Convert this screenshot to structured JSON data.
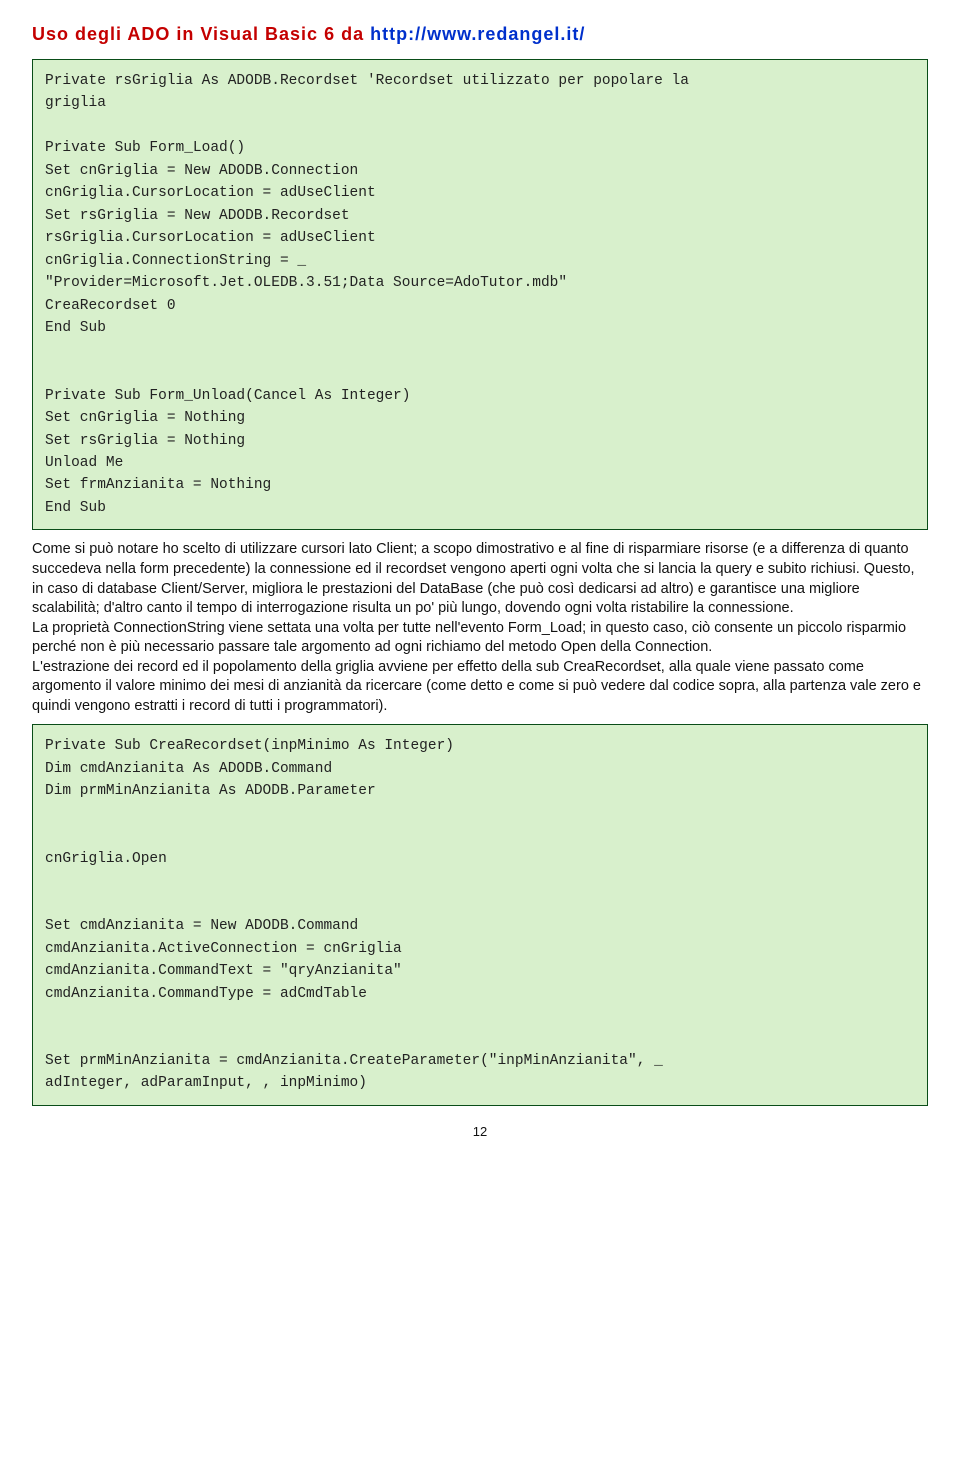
{
  "header": {
    "title_red": "Uso degli ADO in Visual Basic 6 da ",
    "title_blue": "http://www.redangel.it/"
  },
  "code1": "Private rsGriglia As ADODB.Recordset 'Recordset utilizzato per popolare la\ngriglia\n\nPrivate Sub Form_Load()\nSet cnGriglia = New ADODB.Connection\ncnGriglia.CursorLocation = adUseClient\nSet rsGriglia = New ADODB.Recordset\nrsGriglia.CursorLocation = adUseClient\ncnGriglia.ConnectionString = _\n\"Provider=Microsoft.Jet.OLEDB.3.51;Data Source=AdoTutor.mdb\"\nCreaRecordset 0\nEnd Sub\n\n\nPrivate Sub Form_Unload(Cancel As Integer)\nSet cnGriglia = Nothing\nSet rsGriglia = Nothing\nUnload Me\nSet frmAnzianita = Nothing\nEnd Sub",
  "paragraph": "Come si può notare ho scelto di utilizzare cursori lato Client; a scopo dimostrativo e al fine di risparmiare risorse (e a differenza di quanto succedeva nella form precedente) la connessione ed il recordset vengono aperti ogni volta che si lancia la query e subito richiusi. Questo, in caso di database Client/Server, migliora le prestazioni del DataBase (che può così dedicarsi ad altro) e garantisce una migliore scalabilità; d'altro canto il tempo di interrogazione risulta un po' più lungo, dovendo ogni volta ristabilire la connessione.\nLa proprietà ConnectionString viene settata una volta per tutte nell'evento Form_Load; in questo caso, ciò consente un piccolo risparmio perché non è più necessario passare tale argomento ad ogni richiamo del metodo Open della Connection.\nL'estrazione dei record ed il popolamento della griglia avviene per effetto della sub CreaRecordset, alla quale viene passato come argomento il valore minimo dei mesi di anzianità da ricercare (come detto e come si può vedere dal codice sopra, alla partenza vale zero e quindi vengono estratti i record di tutti i programmatori).",
  "code2": "Private Sub CreaRecordset(inpMinimo As Integer)\nDim cmdAnzianita As ADODB.Command\nDim prmMinAnzianita As ADODB.Parameter\n\n\ncnGriglia.Open\n\n\nSet cmdAnzianita = New ADODB.Command\ncmdAnzianita.ActiveConnection = cnGriglia\ncmdAnzianita.CommandText = \"qryAnzianita\"\ncmdAnzianita.CommandType = adCmdTable\n\n\nSet prmMinAnzianita = cmdAnzianita.CreateParameter(\"inpMinAnzianita\", _\nadInteger, adParamInput, , inpMinimo)",
  "page_number": "12"
}
